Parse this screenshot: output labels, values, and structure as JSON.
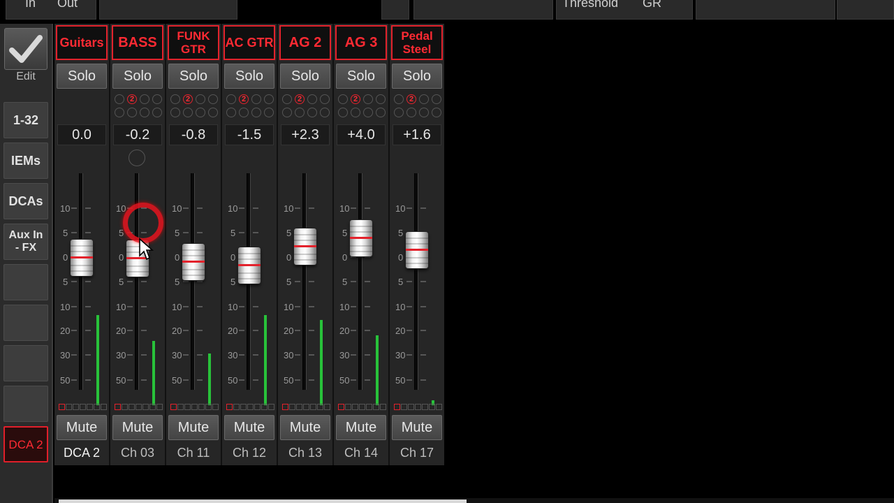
{
  "topbar": {
    "in_label": "In",
    "out_label": "Out",
    "threshold_label": "Threshold",
    "gr_label": "GR"
  },
  "sidebar": {
    "edit_label": "Edit",
    "buttons": [
      {
        "label": "1-32"
      },
      {
        "label": "IEMs"
      },
      {
        "label": "DCAs"
      },
      {
        "label": "Aux In - FX"
      },
      {
        "label": ""
      },
      {
        "label": ""
      },
      {
        "label": ""
      },
      {
        "label": ""
      },
      {
        "label": "DCA 2"
      }
    ]
  },
  "strips": [
    {
      "name_line1": "Guitars",
      "name_line2": "",
      "solo": "Solo",
      "gain": "0.0",
      "mute": "Mute",
      "label": "DCA 2",
      "fader_db": 0.0,
      "meter_level": 0.35,
      "has_dots": false
    },
    {
      "name_line1": "BASS",
      "name_line2": "",
      "solo": "Solo",
      "gain": "-0.2",
      "mute": "Mute",
      "label": "Ch 03",
      "fader_db": -0.2,
      "meter_level": 0.25,
      "has_dots": true,
      "dot_label": "2"
    },
    {
      "name_line1": "FUNK",
      "name_line2": "GTR",
      "solo": "Solo",
      "gain": "-0.8",
      "mute": "Mute",
      "label": "Ch 11",
      "fader_db": -0.8,
      "meter_level": 0.2,
      "has_dots": true,
      "dot_label": "2"
    },
    {
      "name_line1": "AC GTR",
      "name_line2": "",
      "solo": "Solo",
      "gain": "-1.5",
      "mute": "Mute",
      "label": "Ch 12",
      "fader_db": -1.5,
      "meter_level": 0.35,
      "has_dots": true,
      "dot_label": "2"
    },
    {
      "name_line1": "AG 2",
      "name_line2": "",
      "solo": "Solo",
      "gain": "+2.3",
      "mute": "Mute",
      "label": "Ch 13",
      "fader_db": 2.3,
      "meter_level": 0.33,
      "has_dots": true,
      "dot_label": "2"
    },
    {
      "name_line1": "AG 3",
      "name_line2": "",
      "solo": "Solo",
      "gain": "+4.0",
      "mute": "Mute",
      "label": "Ch 14",
      "fader_db": 4.0,
      "meter_level": 0.27,
      "has_dots": true,
      "dot_label": "2"
    },
    {
      "name_line1": "Pedal",
      "name_line2": "Steel",
      "solo": "Solo",
      "gain": "+1.6",
      "mute": "Mute",
      "label": "Ch 17",
      "fader_db": 1.6,
      "meter_level": 0.02,
      "has_dots": true,
      "dot_label": "2"
    }
  ],
  "scale_labels": [
    "10",
    "5",
    "0",
    "5",
    "10",
    "20",
    "30",
    "50"
  ],
  "colors": {
    "accent_red": "#e3222c",
    "meter_green": "#28c23a"
  }
}
